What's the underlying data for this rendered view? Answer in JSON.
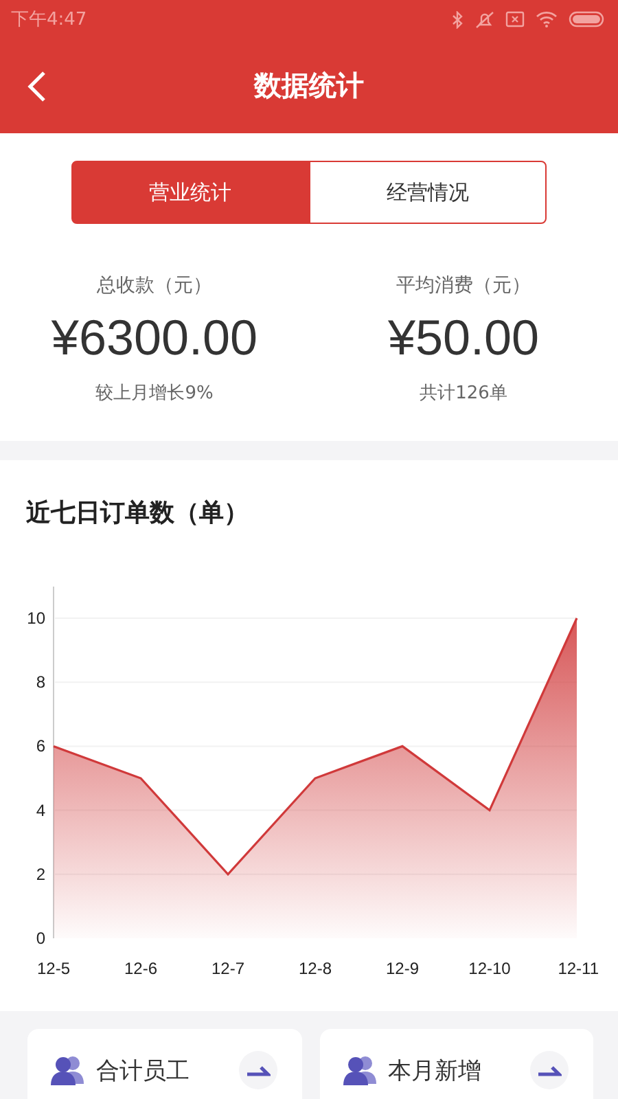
{
  "status_bar": {
    "time": "下午4:47"
  },
  "header": {
    "title": "数据统计"
  },
  "tabs": [
    {
      "label": "营业统计",
      "selected": true
    },
    {
      "label": "经营情况",
      "selected": false
    }
  ],
  "stats": [
    {
      "label": "总收款（元）",
      "value": "¥6300.00",
      "note": "较上月增长9%"
    },
    {
      "label": "平均消费（元）",
      "value": "¥50.00",
      "note": "共计126单"
    }
  ],
  "chart_section": {
    "title": "近七日订单数（单）",
    "chart_data": {
      "type": "area",
      "categories": [
        "12-5",
        "12-6",
        "12-7",
        "12-8",
        "12-9",
        "12-10",
        "12-11"
      ],
      "series": [
        {
          "color": "#d0393a",
          "values": [
            6,
            5,
            2,
            5,
            6,
            4,
            10
          ]
        }
      ],
      "ylim": [
        0,
        10
      ],
      "yticks": [
        0,
        2,
        4,
        6,
        8,
        10
      ],
      "grid": true
    }
  },
  "cards": [
    {
      "label": "合计员工"
    },
    {
      "label": "本月新增"
    }
  ]
}
